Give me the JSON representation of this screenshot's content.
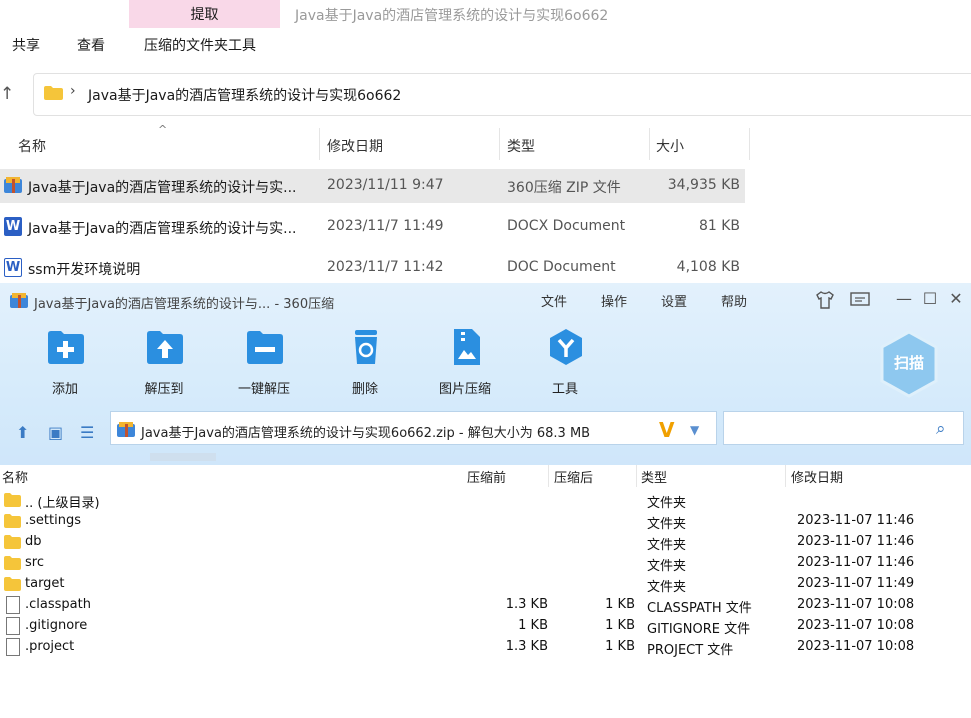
{
  "explorer": {
    "ribbon_tab_active": "提取",
    "window_title": "Java基于Java的酒店管理系统的设计与实现6o662",
    "menu": [
      "共享",
      "查看",
      "压缩的文件夹工具"
    ],
    "address_path": "Java基于Java的酒店管理系统的设计与实现6o662",
    "columns": {
      "name": "名称",
      "modified": "修改日期",
      "type": "类型",
      "size": "大小"
    },
    "rows": [
      {
        "name": "Java基于Java的酒店管理系统的设计与实...",
        "modified": "2023/11/11 9:47",
        "type": "360压缩 ZIP 文件",
        "size": "34,935 KB",
        "icon": "zip-archive-icon",
        "selected": true
      },
      {
        "name": "Java基于Java的酒店管理系统的设计与实...",
        "modified": "2023/11/7 11:49",
        "type": "DOCX Document",
        "size": "81 KB",
        "icon": "word-docx-icon",
        "selected": false
      },
      {
        "name": "ssm开发环境说明",
        "modified": "2023/11/7 11:42",
        "type": "DOC Document",
        "size": "4,108 KB",
        "icon": "word-doc-icon",
        "selected": false
      }
    ]
  },
  "zip": {
    "title": "Java基于Java的酒店管理系统的设计与... - 360压缩",
    "menu": [
      "文件",
      "操作",
      "设置",
      "帮助"
    ],
    "toolbar": [
      {
        "label": "添加",
        "icon": "add-icon"
      },
      {
        "label": "解压到",
        "icon": "extract-to-icon"
      },
      {
        "label": "一键解压",
        "icon": "one-click-extract-icon"
      },
      {
        "label": "删除",
        "icon": "delete-icon"
      },
      {
        "label": "图片压缩",
        "icon": "image-compress-icon"
      },
      {
        "label": "工具",
        "icon": "tools-icon"
      }
    ],
    "scan_label": "扫描",
    "path_text": "Java基于Java的酒店管理系统的设计与实现6o662.zip - 解包大小为 68.3 MB",
    "search_placeholder": "",
    "columns": {
      "name": "名称",
      "before": "压缩前",
      "after": "压缩后",
      "type": "类型",
      "modified": "修改日期"
    },
    "rows": [
      {
        "name": ".. (上级目录)",
        "before": "",
        "after": "",
        "type": "文件夹",
        "modified": "",
        "kind": "folder"
      },
      {
        "name": ".settings",
        "before": "",
        "after": "",
        "type": "文件夹",
        "modified": "2023-11-07 11:46",
        "kind": "folder"
      },
      {
        "name": "db",
        "before": "",
        "after": "",
        "type": "文件夹",
        "modified": "2023-11-07 11:46",
        "kind": "folder"
      },
      {
        "name": "src",
        "before": "",
        "after": "",
        "type": "文件夹",
        "modified": "2023-11-07 11:46",
        "kind": "folder"
      },
      {
        "name": "target",
        "before": "",
        "after": "",
        "type": "文件夹",
        "modified": "2023-11-07 11:49",
        "kind": "folder"
      },
      {
        "name": ".classpath",
        "before": "1.3 KB",
        "after": "1 KB",
        "type": "CLASSPATH 文件",
        "modified": "2023-11-07 10:08",
        "kind": "file"
      },
      {
        "name": ".gitignore",
        "before": "1 KB",
        "after": "1 KB",
        "type": "GITIGNORE 文件",
        "modified": "2023-11-07 10:08",
        "kind": "file"
      },
      {
        "name": ".project",
        "before": "1.3 KB",
        "after": "1 KB",
        "type": "PROJECT 文件",
        "modified": "2023-11-07 10:08",
        "kind": "file"
      }
    ]
  },
  "colors": {
    "accent": "#2b8fe0",
    "selected_row": "#e8e8e8",
    "ribbon_tab": "#f9d8e8",
    "zip_header": "#d6ebfb"
  }
}
